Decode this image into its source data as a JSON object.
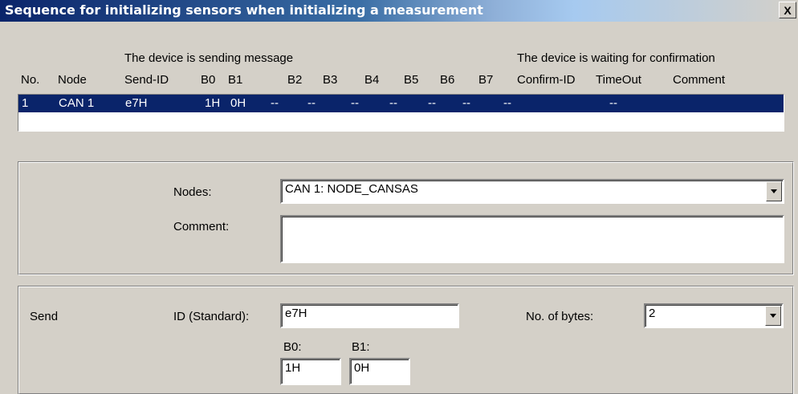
{
  "window": {
    "title": "Sequence for initializing sensors when initializing a measurement",
    "close_label": "X"
  },
  "table": {
    "group_sending": "The device is sending message",
    "group_waiting": "The device is waiting for confirmation",
    "columns": [
      "No.",
      "Node",
      "Send-ID",
      "B0",
      "B1",
      "B2",
      "B3",
      "B4",
      "B5",
      "B6",
      "B7",
      "Confirm-ID",
      "TimeOut",
      "Comment"
    ],
    "rows": [
      [
        "1",
        "CAN 1",
        "e7H",
        "1H",
        "0H",
        "--",
        "--",
        "--",
        "--",
        "--",
        "--",
        "--",
        "--",
        ""
      ]
    ]
  },
  "node_group": {
    "nodes_label": "Nodes:",
    "nodes_value": "CAN 1: NODE_CANSAS",
    "comment_label": "Comment:",
    "comment_value": ""
  },
  "send_group": {
    "send_label": "Send",
    "id_label": "ID (Standard):",
    "id_value": "e7H",
    "bytes_label": "No. of bytes:",
    "bytes_value": "2",
    "b0_label": "B0:",
    "b0_value": "1H",
    "b1_label": "B1:",
    "b1_value": "0H"
  },
  "colors": {
    "selection": "#0a246a",
    "face": "#d4d0c8"
  }
}
